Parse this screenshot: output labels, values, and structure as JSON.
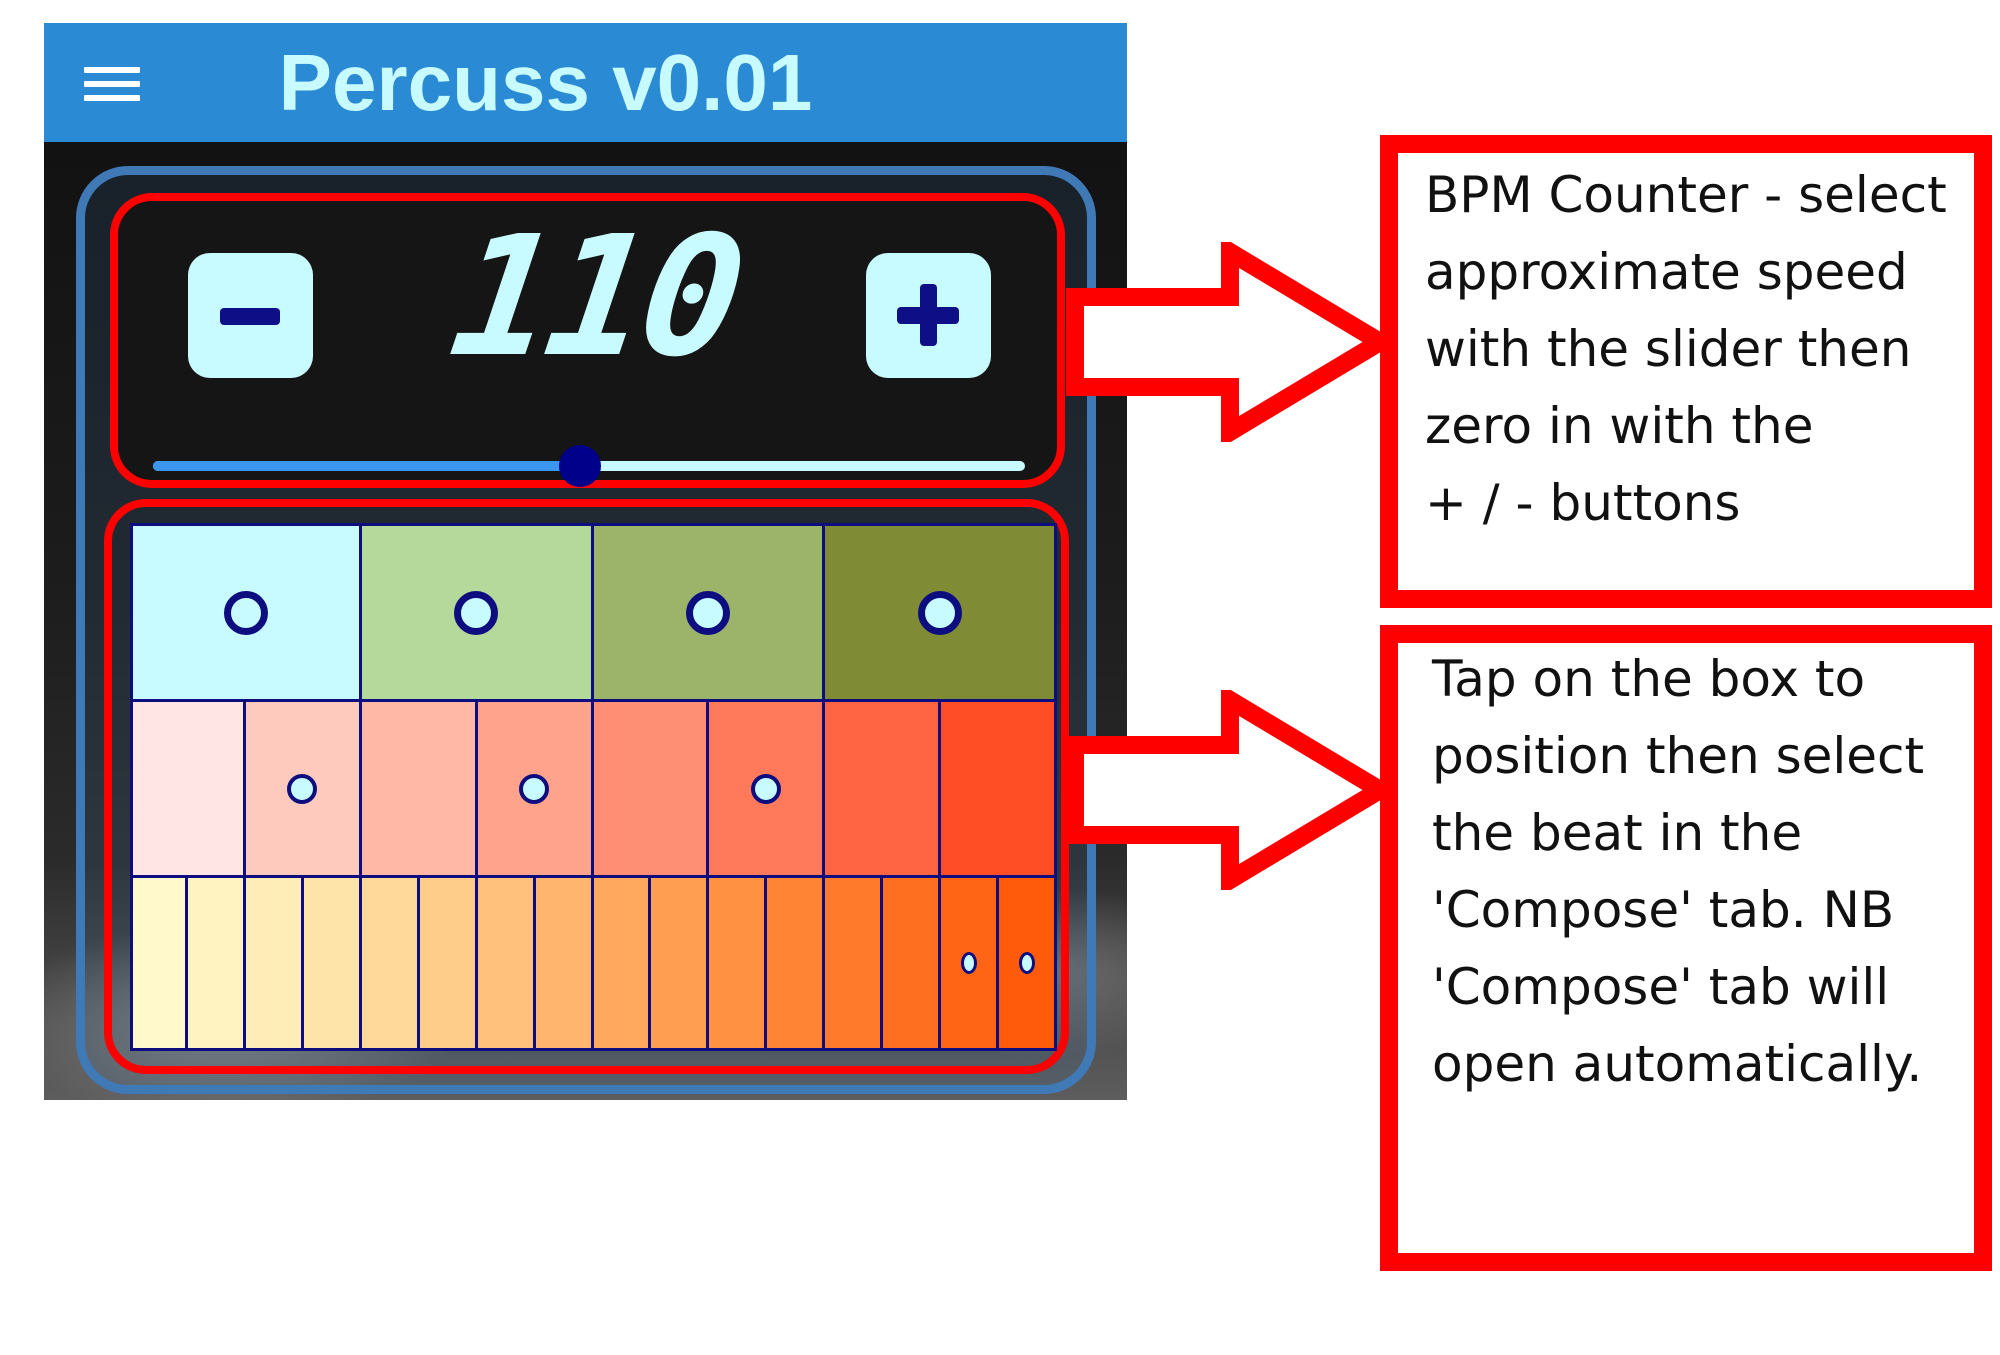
{
  "app": {
    "title": "Percuss v0.01",
    "menu_icon": "hamburger-menu-icon"
  },
  "bpm": {
    "value": "110",
    "minus_label": "−",
    "plus_label": "+",
    "slider_fraction": 0.49,
    "colors": {
      "display_bg": "#151515",
      "accent": "#c8fbff",
      "thumb": "#00008b",
      "fill": "#3b96f0"
    }
  },
  "grid": {
    "rows": [
      {
        "name": "quarter",
        "colors": [
          "#c8fbff",
          "#b4d99a",
          "#9cb46a",
          "#808b36"
        ],
        "active": [
          0,
          1,
          2,
          3
        ]
      },
      {
        "name": "eighth",
        "colors": [
          "#ffe6e4",
          "#ffcabe",
          "#ffb7a6",
          "#ffa38d",
          "#ff8f74",
          "#ff7a5b",
          "#ff6542",
          "#ff4d26"
        ],
        "active": [
          1,
          3,
          5
        ]
      },
      {
        "name": "sixteenth",
        "colors": [
          "#fff9cc",
          "#fff3c2",
          "#ffedb7",
          "#ffe4a9",
          "#ffd99a",
          "#ffcd8a",
          "#ffc17c",
          "#ffb56e",
          "#ffa95f",
          "#ff9d50",
          "#ff9142",
          "#ff8535",
          "#ff7a2a",
          "#ff6f20",
          "#ff6515",
          "#ff5b0a"
        ],
        "active": [
          14,
          15
        ]
      }
    ]
  },
  "annotations": [
    {
      "lines": [
        "BPM Counter - select",
        "approximate speed",
        "with the slider then",
        "zero in with the",
        "+ / - buttons"
      ]
    },
    {
      "lines": [
        "Tap on the box to",
        "position then select",
        "the beat in the",
        "'Compose' tab. NB",
        "'Compose' tab will",
        "open automatically."
      ]
    }
  ],
  "colors": {
    "annotation_red": "#fe0000",
    "app_bar": "#2a8ad4",
    "panel_border": "#3f79b6"
  }
}
